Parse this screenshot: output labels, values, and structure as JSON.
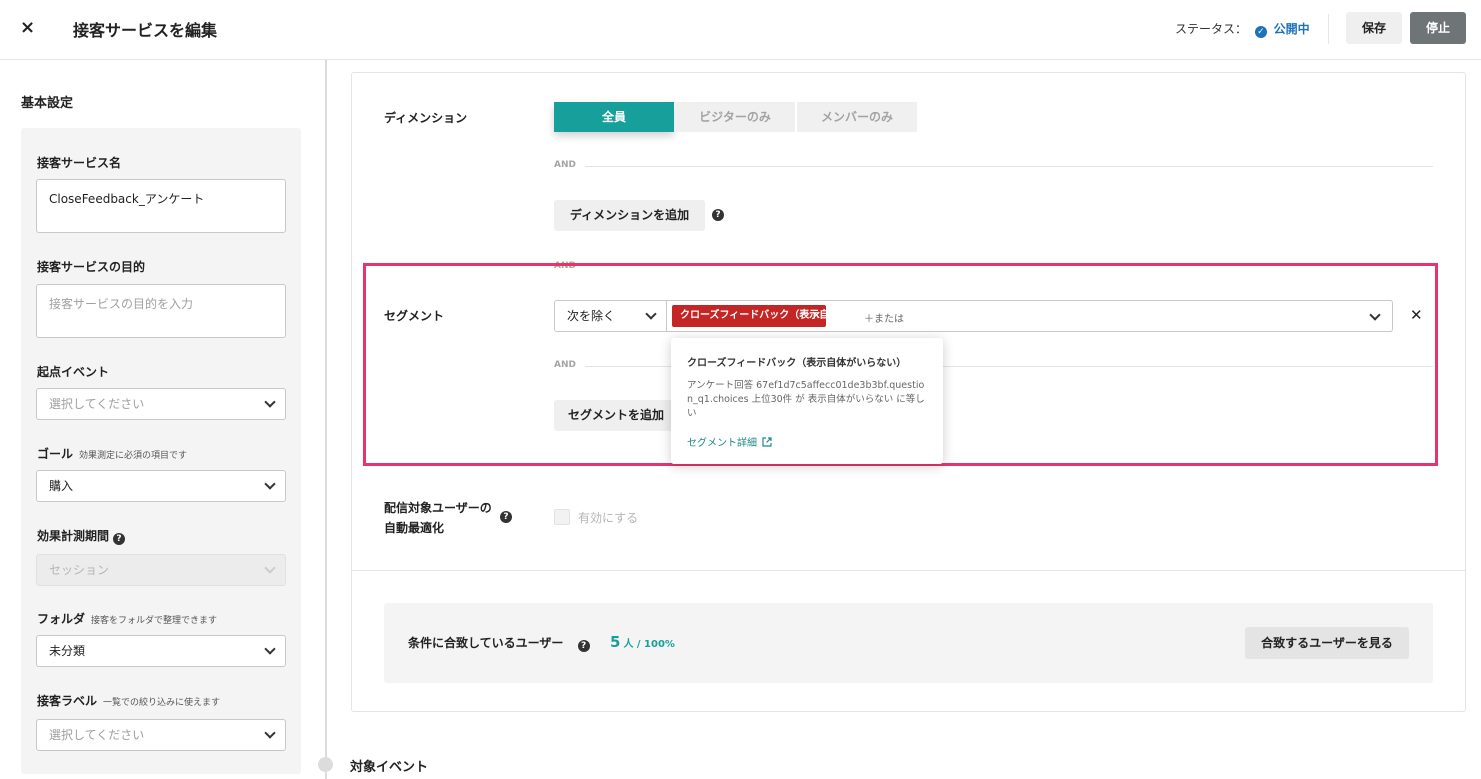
{
  "header": {
    "close_glyph": "×",
    "title": "接客サービスを編集",
    "status_label": "ステータス：",
    "status_check": "✓",
    "status_value": "公開中",
    "save_label": "保存",
    "stop_label": "停止"
  },
  "sidebar": {
    "section_title": "基本設定",
    "name_label": "接客サービス名",
    "name_value": "CloseFeedback_アンケート",
    "purpose_label": "接客サービスの目的",
    "purpose_placeholder": "接客サービスの目的を入力",
    "start_event_label": "起点イベント",
    "start_event_placeholder": "選択してください",
    "goal_label": "ゴール",
    "goal_hint": "効果測定に必須の項目です",
    "goal_value": "購入",
    "period_label": "効果計測期間",
    "period_value": "セッション",
    "folder_label": "フォルダ",
    "folder_hint": "接客をフォルダで整理できます",
    "folder_value": "未分類",
    "label_label": "接客ラベル",
    "label_hint": "一覧での絞り込みに使えます",
    "label_placeholder": "選択してください"
  },
  "main": {
    "dimension_label": "ディメンション",
    "dimension_tabs": [
      "全員",
      "ビジターのみ",
      "メンバーのみ"
    ],
    "dimension_selected": "全員",
    "and_text": "AND",
    "add_dimension": "ディメンションを追加",
    "segment_label": "セグメント",
    "segment_mode": "次を除く",
    "segment_tag": "クローズフィードバック（表示自...",
    "segment_tag_x": "✕",
    "or_text": "＋または",
    "remove_glyph": "✕",
    "add_segment": "セグメントを追加",
    "popover": {
      "title": "クローズフィードバック（表示自体がいらない）",
      "body": "アンケート回答 67ef1d7c5affecc01de3b3bf.question_q1.choices 上位30件 が 表示自体がいらない に等しい",
      "link": "セグメント詳細"
    },
    "auto_opt_label_1": "配信対象ユーザーの",
    "auto_opt_label_2": "自動最適化",
    "auto_opt_checkbox": "有効にする",
    "match_label": "条件に合致しているユーザー",
    "match_count": "5",
    "match_unit": "人 / 100%",
    "match_button": "合致するユーザーを見る",
    "next_section": "対象イベント",
    "help_glyph": "?"
  },
  "colors": {
    "accent": "#17a09b",
    "status_blue": "#1d72b8",
    "tag_red": "#c42626",
    "highlight_pink": "#e7346c"
  }
}
